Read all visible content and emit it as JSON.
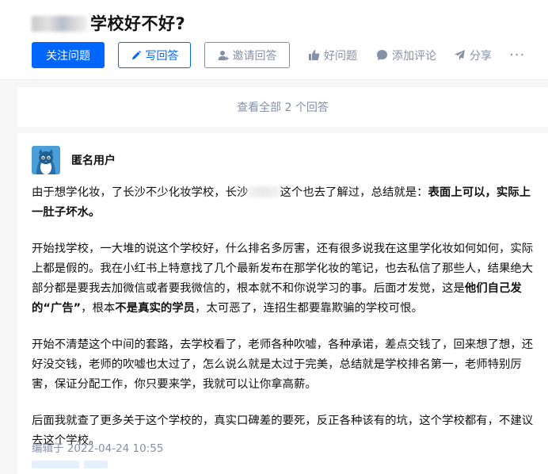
{
  "question": {
    "title_suffix": "学校好不好?"
  },
  "actions": {
    "follow": "关注问题",
    "write": "写回答",
    "invite": "邀请回答",
    "good": "好问题",
    "comment": "添加评论",
    "share": "分享",
    "more": "···"
  },
  "view_all": "查看全部 2 个回答",
  "answer": {
    "author": "匿名用户",
    "p1": {
      "a": "由于想学化妆，了长沙不少化妆学校，长沙",
      "b": "这个也去了解过，总结就是：",
      "bold": "表面上可以，实际上一肚子坏水。"
    },
    "p2": {
      "a": "开始找学校，一大堆的说这个学校好，什么排名多厉害，还有很多说我在这里学化妆如何如何，实际上都是假的。我在小红书上特意找了几个最新发布在那学化妆的笔记，也去私信了那些人，结果绝大部分都是要我去加微信或者要我微信的，根本就不和你说学习的事。后面才发觉，这是",
      "bold1": "他们自己发的“广告”",
      "b": "，根本",
      "bold2": "不是真实的学员",
      "c": "，太可恶了，连招生都要靠欺骗的学校可恨。"
    },
    "p3": "开始不清楚这个中间的套路，去学校看了，老师各种吹嘘，各种承诺，差点交钱了，回来想了想，还好没交钱，老师的吹嘘也太过了，怎么说么就是太过于完美，总结就是学校排名第一，老师特别厉害，保证分配工作，你只要来学，我就可以让你拿高薪。",
    "p4": "后面我就查了更多关于这个学校的，真实口碑差的要死，反正各种该有的坑，这个学校都有，不建议去这个学校。",
    "edited": "编辑于 2022-04-24 10:55"
  },
  "colors": {
    "primary": "#0066ff",
    "gray": "#8590a6",
    "text": "#121212",
    "background": "#f6f6f6"
  },
  "icons": [
    "pen-icon",
    "invite-user-icon",
    "thumb-up-icon",
    "comment-bubble-icon",
    "share-arrow-icon",
    "anonymous-avatar-icon"
  ]
}
